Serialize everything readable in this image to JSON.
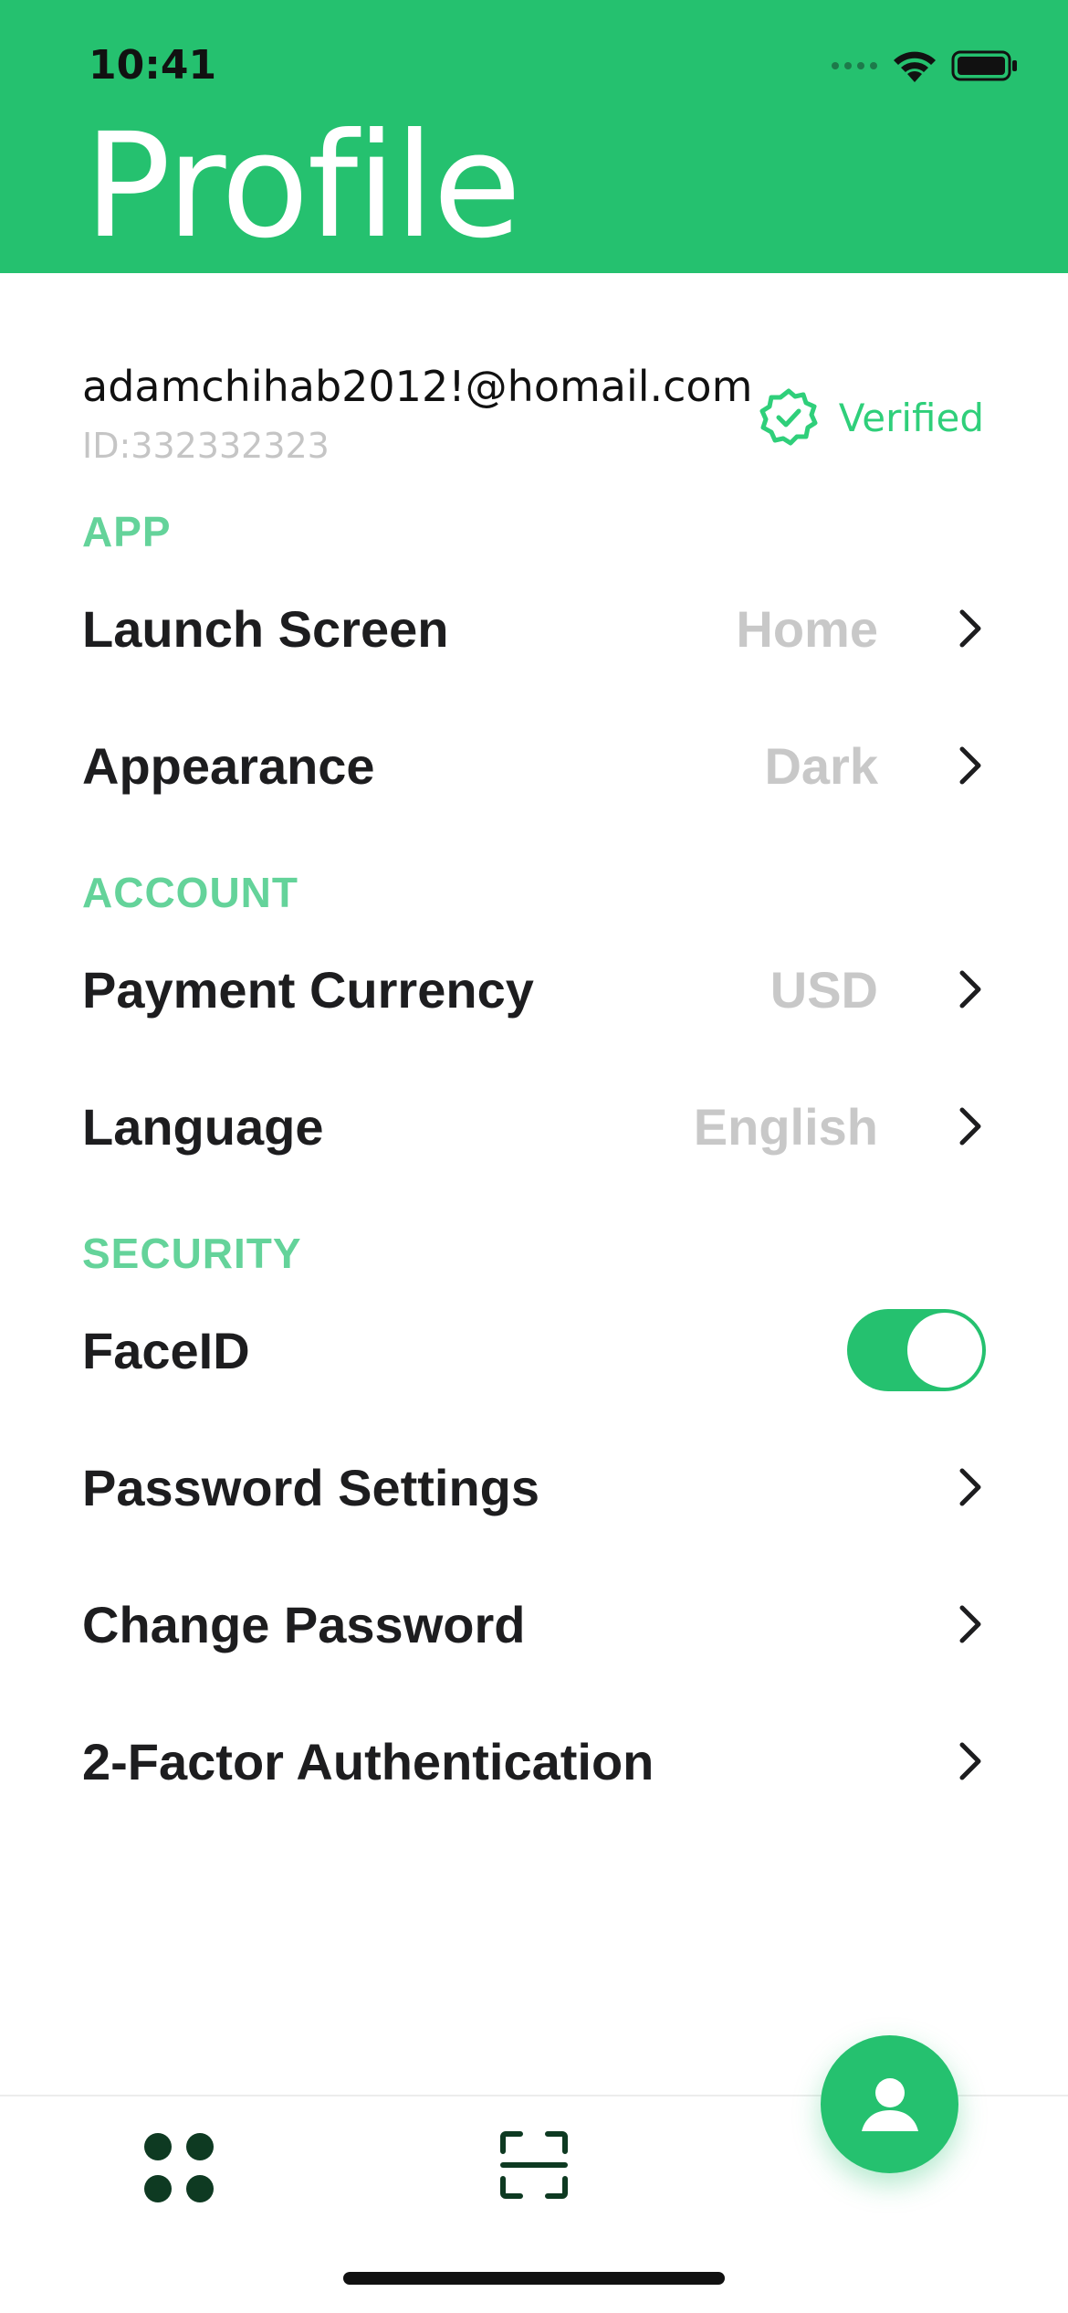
{
  "status_bar": {
    "time": "10:41"
  },
  "header": {
    "title": "Profile"
  },
  "account": {
    "email": "adamchihab2012!@homail.com",
    "id": "ID:332332323",
    "verified_label": "Verified"
  },
  "sections": {
    "app": {
      "title": "APP",
      "launch_screen": {
        "label": "Launch Screen",
        "value": "Home"
      },
      "appearance": {
        "label": "Appearance",
        "value": "Dark"
      }
    },
    "account": {
      "title": "ACCOUNT",
      "payment_currency": {
        "label": "Payment Currency",
        "value": "USD"
      },
      "language": {
        "label": "Language",
        "value": "English"
      }
    },
    "security": {
      "title": "SECURITY",
      "face_id": {
        "label": "FaceID",
        "enabled": true
      },
      "password_settings": {
        "label": "Password Settings"
      },
      "change_password": {
        "label": "Change Password"
      },
      "two_factor": {
        "label": "2-Factor Authentication"
      }
    }
  },
  "tab_bar": {
    "items": [
      {
        "icon": "apps-grid-icon"
      },
      {
        "icon": "scan-icon"
      },
      {
        "icon": "profile-icon",
        "active": true
      }
    ]
  },
  "colors": {
    "brand_green": "#25c16f",
    "section_label": "#64d39a",
    "value_gray": "#c8c8c8",
    "dark_icon": "#0e3a22"
  }
}
